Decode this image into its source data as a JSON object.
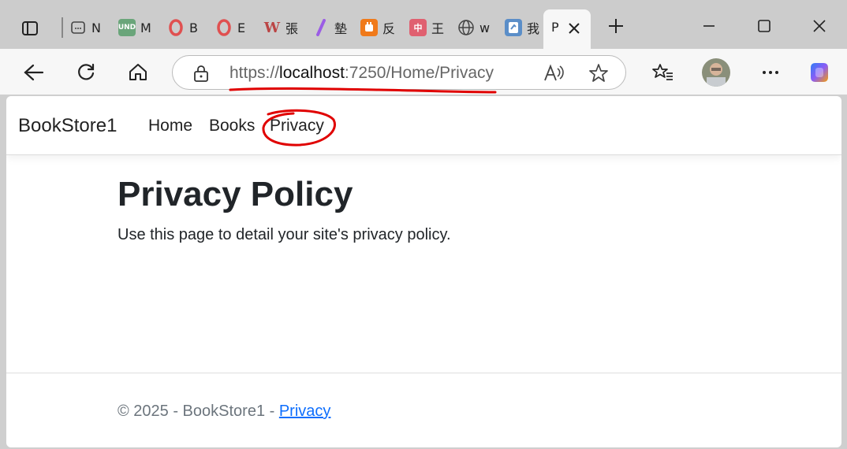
{
  "tabs": [
    {
      "icon": "calendar-icon",
      "label": "N"
    },
    {
      "icon": "und-icon",
      "label": "M",
      "badge": "UND"
    },
    {
      "icon": "opera-icon",
      "label": "B"
    },
    {
      "icon": "opera-icon",
      "label": "E"
    },
    {
      "icon": "w-icon",
      "label": "張"
    },
    {
      "icon": "slash-icon",
      "label": "墊"
    },
    {
      "icon": "plug-icon",
      "label": "反"
    },
    {
      "icon": "pink-icon",
      "label": "王"
    },
    {
      "icon": "globe-icon",
      "label": "w"
    },
    {
      "icon": "doc-icon",
      "label": "我"
    }
  ],
  "active_tab": {
    "label": "P"
  },
  "address": {
    "scheme": "https://",
    "host": "localhost",
    "rest": ":7250/Home/Privacy"
  },
  "site": {
    "brand": "BookStore1",
    "nav": [
      "Home",
      "Books",
      "Privacy"
    ],
    "title": "Privacy Policy",
    "body": "Use this page to detail your site's privacy policy.",
    "footer_text": "© 2025 - BookStore1 - ",
    "footer_link": "Privacy"
  },
  "colors": {
    "link": "#0d6efd",
    "annotation": "#e00000",
    "text": "#212529"
  }
}
